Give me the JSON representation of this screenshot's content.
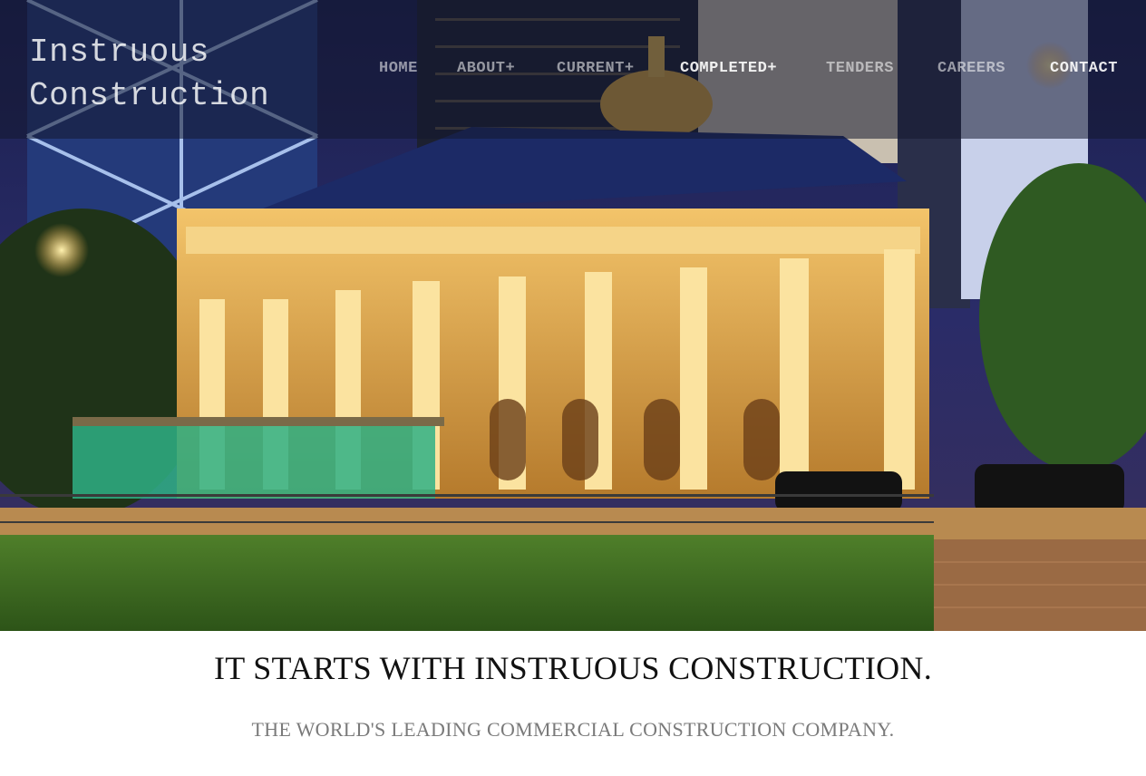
{
  "site": {
    "logo_line1": "Instruous",
    "logo_line2": "Construction"
  },
  "nav": {
    "items": [
      {
        "label": "HOME"
      },
      {
        "label": "ABOUT+"
      },
      {
        "label": "CURRENT+"
      },
      {
        "label": "COMPLETED+"
      },
      {
        "label": "TENDERS"
      },
      {
        "label": "CAREERS"
      },
      {
        "label": "CONTACT"
      }
    ]
  },
  "hero": {
    "image_icon": "night-cityscape-courthouse-photo"
  },
  "main": {
    "headline": "IT STARTS WITH INSTRUOUS CONSTRUCTION.",
    "subheadline": "THE WORLD'S LEADING COMMERCIAL CONSTRUCTION COMPANY."
  },
  "colors": {
    "nav_overlay": "#141830",
    "headline": "#111111",
    "subheadline": "#7a7a7a"
  }
}
